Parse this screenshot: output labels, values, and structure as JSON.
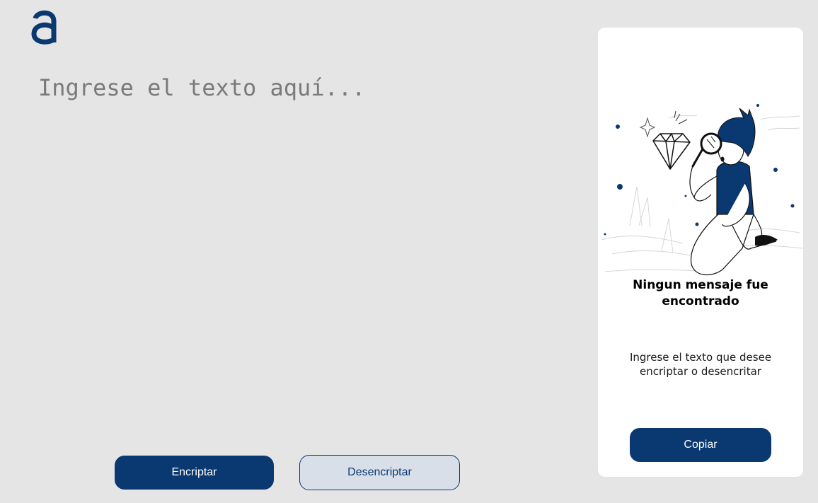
{
  "logo": {
    "icon": "alura-logo-icon",
    "color": "#0a3871"
  },
  "editor": {
    "placeholder": "Ingrese el texto aquí...",
    "value": ""
  },
  "actions": {
    "encrypt_label": "Encriptar",
    "decrypt_label": "Desencriptar"
  },
  "output_panel": {
    "title": "Ningun mensaje fue encontrado",
    "description": "Ingrese el texto que desee encriptar o desencritar",
    "copy_label": "Copiar",
    "illustration": "person-with-magnifying-glass-and-diamond"
  },
  "colors": {
    "background": "#e5e5e5",
    "primary": "#0a3871",
    "secondary_button": "#d8dfe8",
    "panel": "#ffffff",
    "placeholder": "#7a7a7a"
  }
}
